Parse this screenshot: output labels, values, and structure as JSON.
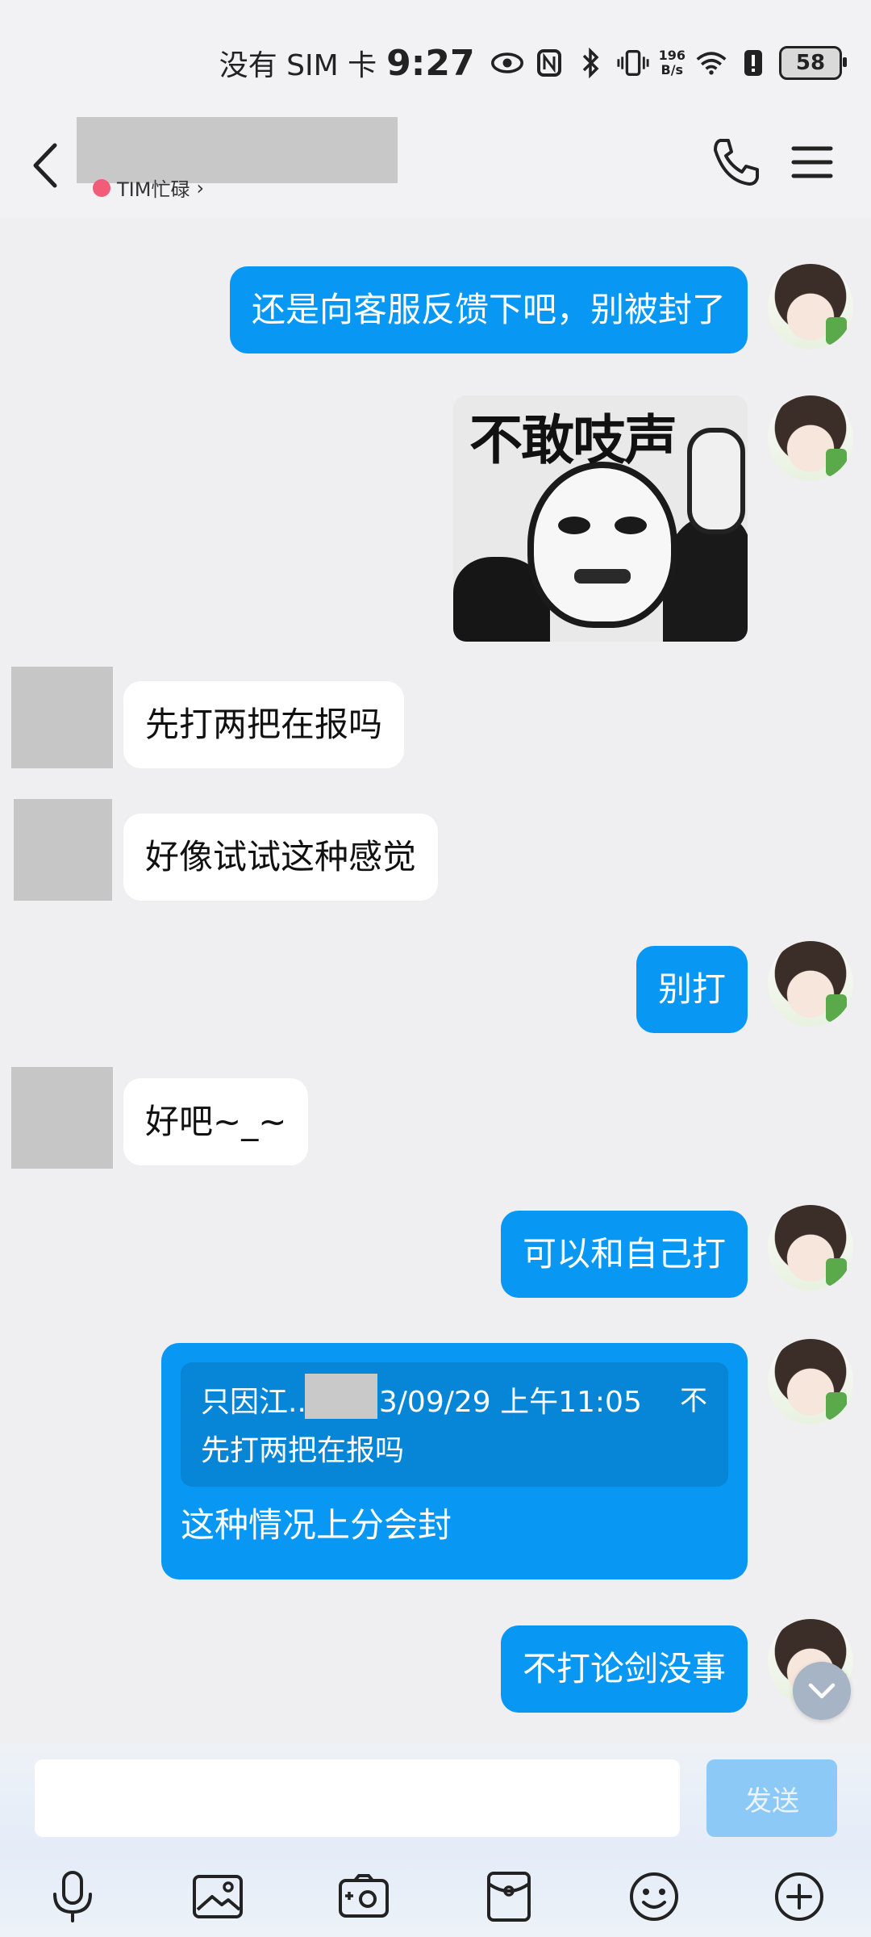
{
  "status_bar": {
    "carrier": "没有 SIM 卡",
    "time": "9:27",
    "net_speed_value": "196",
    "net_speed_unit": "B/s",
    "battery": "58"
  },
  "header": {
    "contact_status": "TIM忙碌"
  },
  "messages": {
    "m1": "还是向客服反馈下吧，别被封了",
    "sticker_text": "不敢吱声",
    "m3": "先打两把在报吗",
    "m4": "好像试试这种感觉",
    "m5": "别打",
    "m6": "好吧~_~",
    "m7": "可以和自己打",
    "reply": {
      "quote_sender": "只因江..",
      "quote_time": "3/09/29 上午11:05",
      "quote_close": "不",
      "quote_text": "先打两把在报吗",
      "text": "这种情况上分会封"
    },
    "m9": "不打论剑没事"
  },
  "composer": {
    "input_value": "",
    "input_placeholder": "",
    "send_label": "发送"
  },
  "colors": {
    "self_bubble": "#0898f3",
    "other_bubble": "#ffffff",
    "background": "#efeff1",
    "send_button": "#8cc9f7"
  },
  "toolbar_icons": [
    "microphone-icon",
    "image-icon",
    "camera-icon",
    "red-packet-icon",
    "emoji-icon",
    "plus-icon"
  ]
}
